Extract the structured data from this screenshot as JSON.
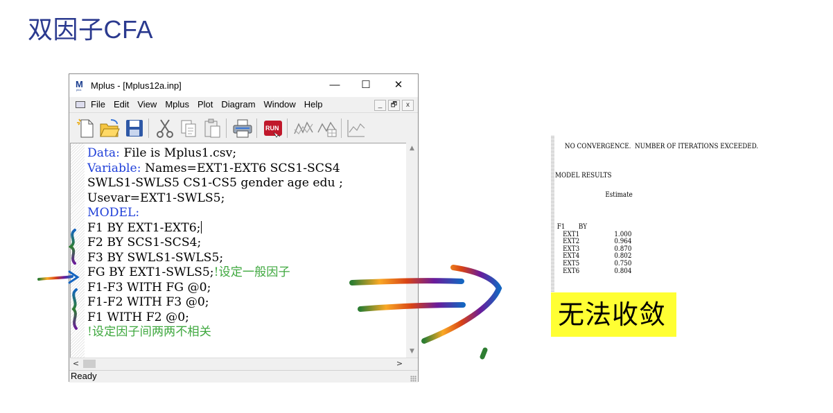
{
  "slide": {
    "title": "双因子CFA"
  },
  "window": {
    "title": "Mplus - [Mplus12a.inp]",
    "app_icon_text": "M",
    "controls": {
      "minimize": "—",
      "maximize": "☐",
      "close": "✕"
    },
    "menu": [
      "File",
      "Edit",
      "View",
      "Mplus",
      "Plot",
      "Diagram",
      "Window",
      "Help"
    ],
    "mdi_controls": [
      "_",
      "🗗",
      "x"
    ],
    "toolbar_icons": [
      "new-file-icon",
      "open-folder-icon",
      "save-icon",
      "cut-icon",
      "copy-icon",
      "paste-icon",
      "print-icon",
      "run-icon",
      "plot-1-icon",
      "plot-2-icon",
      "plot-3-icon"
    ],
    "run_label": "RUN",
    "status": "Ready",
    "scroll_left": "<",
    "scroll_right": ">"
  },
  "code": [
    {
      "kw": "Data:",
      "text": " File is Mplus1.csv;"
    },
    {
      "kw": "Variable:",
      "text": " Names=EXT1-EXT6 SCS1-SCS4"
    },
    {
      "kw": "",
      "text": "SWLS1-SWLS5 CS1-CS5 gender age edu ;"
    },
    {
      "kw": "",
      "text": "Usevar=EXT1-SWLS5;"
    },
    {
      "kw": "MODEL:",
      "text": ""
    },
    {
      "kw": "",
      "text": "F1 BY EXT1-EXT6;"
    },
    {
      "kw": "",
      "text": "F2 BY SCS1-SCS4;"
    },
    {
      "kw": "",
      "text": "F3 BY SWLS1-SWLS5;"
    },
    {
      "kw": "",
      "text": "FG BY EXT1-SWLS5;",
      "comment": "!设定一般因子"
    },
    {
      "kw": "",
      "text": "F1-F3 WITH FG @0;"
    },
    {
      "kw": "",
      "text": "F1-F2 WITH F3 @0;"
    },
    {
      "kw": "",
      "text": "F1 WITH F2 @0;"
    },
    {
      "kw": "",
      "text": "",
      "comment": "!设定因子间两两不相关"
    }
  ],
  "output": {
    "warning": "     NO CONVERGENCE.  NUMBER OF ITERATIONS EXCEEDED.",
    "section": "MODEL RESULTS",
    "header": "                          Estimate",
    "factor_line": " F1       BY",
    "rows": [
      {
        "name": "EXT1",
        "estimate": "1.000"
      },
      {
        "name": "EXT2",
        "estimate": "0.964"
      },
      {
        "name": "EXT3",
        "estimate": "0.870"
      },
      {
        "name": "EXT4",
        "estimate": "0.802"
      },
      {
        "name": "EXT5",
        "estimate": "0.750"
      },
      {
        "name": "EXT6",
        "estimate": "0.804"
      }
    ]
  },
  "badge": {
    "text": "无法收敛",
    "color": "#ffff33"
  }
}
